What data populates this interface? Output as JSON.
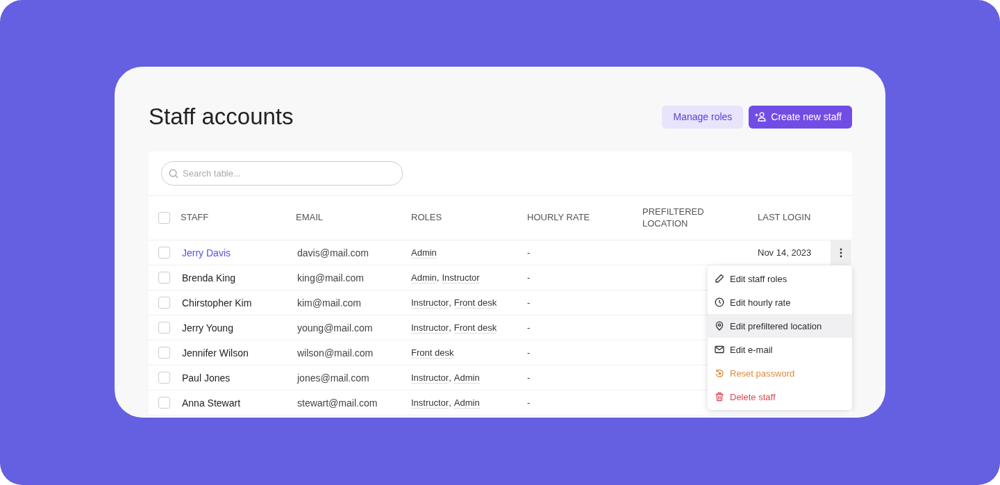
{
  "page": {
    "title": "Staff accounts"
  },
  "actions": [
    {
      "label": "Manage roles",
      "kind": "secondary"
    },
    {
      "label": "Create new staff",
      "kind": "primary"
    }
  ],
  "search": {
    "placeholder": "Search table..."
  },
  "table": {
    "select_all_checked": false,
    "columns": [
      "STAFF",
      "EMAIL",
      "ROLES",
      "HOURLY RATE",
      "PREFILTERED LOCATION",
      "LAST LOGIN"
    ],
    "rows": [
      {
        "name": "Jerry Davis",
        "email": "davis@mail.com",
        "roles": [
          {
            "label": "Admin"
          }
        ],
        "hourly_rate": "-",
        "last_login": "Nov 14, 2023",
        "active": true,
        "checked": false
      },
      {
        "name": "Brenda King",
        "email": "king@mail.com",
        "roles": [
          {
            "label": "Admin",
            "separator": ","
          },
          {
            "label": "Instructor"
          }
        ],
        "hourly_rate": "-",
        "active": false,
        "checked": false
      },
      {
        "name": "Chirstopher Kim",
        "email": "kim@mail.com",
        "roles": [
          {
            "label": "Instructor",
            "separator": ","
          },
          {
            "label": "Front desk"
          }
        ],
        "hourly_rate": "-",
        "active": false,
        "checked": false
      },
      {
        "name": "Jerry Young",
        "email": "young@mail.com",
        "roles": [
          {
            "label": "Instructor",
            "separator": ","
          },
          {
            "label": "Front desk"
          }
        ],
        "hourly_rate": "-",
        "active": false,
        "checked": false
      },
      {
        "name": "Jennifer Wilson",
        "email": "wilson@mail.com",
        "roles": [
          {
            "label": "Front desk"
          }
        ],
        "hourly_rate": "-",
        "active": false,
        "checked": false
      },
      {
        "name": "Paul Jones",
        "email": "jones@mail.com",
        "roles": [
          {
            "label": "Instructor",
            "separator": ","
          },
          {
            "label": "Admin"
          }
        ],
        "hourly_rate": "-",
        "active": false,
        "checked": false
      },
      {
        "name": "Anna Stewart",
        "email": "stewart@mail.com",
        "roles": [
          {
            "label": "Instructor",
            "separator": ","
          },
          {
            "label": "Admin"
          }
        ],
        "hourly_rate": "-",
        "active": false,
        "checked": false
      }
    ]
  },
  "menu": [
    {
      "label": "Edit staff roles",
      "kind": "normal",
      "highlighted": false
    },
    {
      "label": "Edit hourly rate",
      "kind": "normal",
      "highlighted": false
    },
    {
      "label": "Edit prefiltered location",
      "kind": "normal",
      "highlighted": true
    },
    {
      "label": "Edit e-mail",
      "kind": "normal",
      "highlighted": false
    },
    {
      "label": "Reset password",
      "kind": "warning",
      "highlighted": false
    },
    {
      "label": "Delete staff",
      "kind": "danger",
      "highlighted": false
    }
  ]
}
